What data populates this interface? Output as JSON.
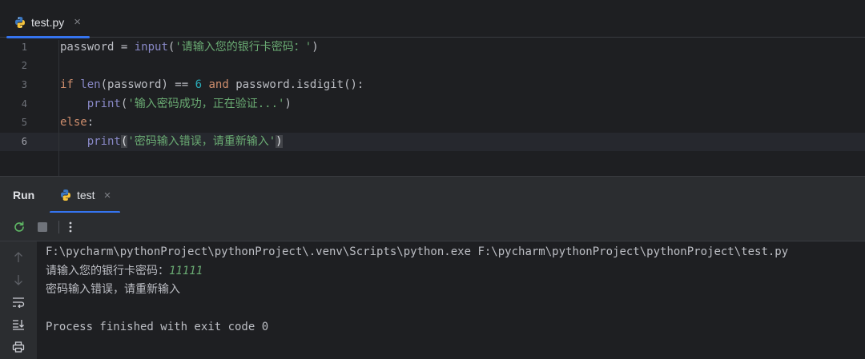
{
  "editor_tabs": [
    {
      "label": "test.py",
      "close": "×"
    }
  ],
  "line_numbers": [
    "1",
    "2",
    "3",
    "4",
    "5",
    "6"
  ],
  "code": {
    "l1": {
      "var": "password",
      "op": " = ",
      "func": "input",
      "open": "(",
      "str": "'请输入您的银行卡密码：'",
      "close": ")"
    },
    "l3": {
      "kw_if": "if",
      "func": "len",
      "args": "(password) == ",
      "num": "6",
      "kw_and": "and",
      "tail": " password.isdigit():"
    },
    "l4": {
      "indent": "    ",
      "func": "print",
      "open": "(",
      "str": "'输入密码成功，正在验证...'",
      "close": ")"
    },
    "l5": {
      "kw_else": "else",
      "colon": ":"
    },
    "l6": {
      "indent": "    ",
      "func": "print",
      "open": "(",
      "str": "'密码输入错误，请重新输入'",
      "close": ")"
    }
  },
  "run_panel": {
    "title": "Run",
    "tab_label": "test",
    "tab_close": "×"
  },
  "console": {
    "command": "F:\\pycharm\\pythonProject\\pythonProject\\.venv\\Scripts\\python.exe F:\\pycharm\\pythonProject\\pythonProject\\test.py",
    "prompt": "请输入您的银行卡密码：",
    "user_input": "11111",
    "output": "密码输入错误，请重新输入",
    "exit": "Process finished with exit code 0"
  },
  "icons": {
    "file": "python-file-icon",
    "rerun": "rerun-icon",
    "stop": "stop-icon",
    "more": "more-vertical-icon",
    "up": "arrow-up-icon",
    "down": "arrow-down-icon",
    "wrap": "soft-wrap-icon",
    "scroll_end": "scroll-to-end-icon",
    "print": "print-icon"
  },
  "colors": {
    "accent": "#3574f0",
    "keyword": "#cf8e6d",
    "string": "#6aab73",
    "function": "#56a8f5",
    "number": "#2aacb8"
  }
}
